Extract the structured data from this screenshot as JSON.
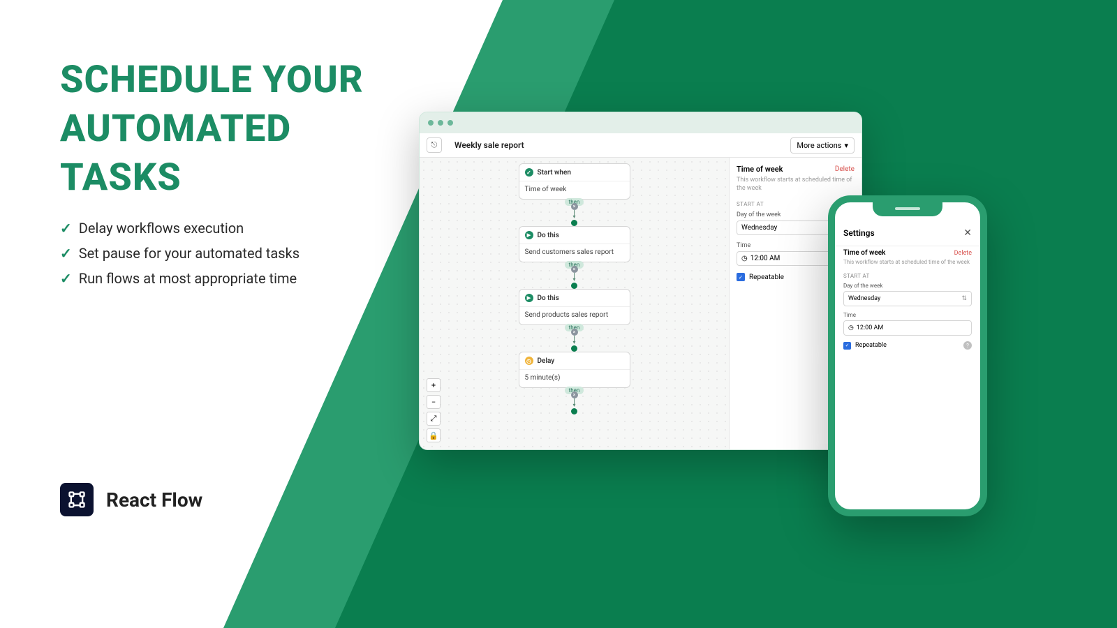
{
  "hero": {
    "heading_l1": "SCHEDULE YOUR",
    "heading_l2": "AUTOMATED",
    "heading_l3": "TASKS",
    "bullets": [
      "Delay workflows execution",
      "Set pause for your automated tasks",
      "Run flows at most appropriate time"
    ],
    "brand": "React Flow"
  },
  "desktop": {
    "title": "Weekly sale report",
    "more_actions": "More actions",
    "nodes": [
      {
        "head": "Start when",
        "body": "Time of week",
        "icon": "check"
      },
      {
        "head": "Do this",
        "body": "Send customers sales report",
        "icon": "play"
      },
      {
        "head": "Do this",
        "body": "Send products sales report",
        "icon": "play"
      },
      {
        "head": "Delay",
        "body": "5 minute(s)",
        "icon": "clock"
      }
    ],
    "connector_label": "then",
    "panel": {
      "title": "Time of week",
      "delete": "Delete",
      "desc": "This workflow starts at scheduled time of the week",
      "section_label": "START AT",
      "day_label": "Day of the week",
      "day_value": "Wednesday",
      "time_label": "Time",
      "time_value": "12:00 AM",
      "repeatable_label": "Repeatable"
    }
  },
  "mobile": {
    "title": "Settings",
    "panel": {
      "title": "Time of week",
      "delete": "Delete",
      "desc": "This workflow starts at scheduled time of the week",
      "section_label": "START AT",
      "day_label": "Day of the week",
      "day_value": "Wednesday",
      "time_label": "Time",
      "time_value": "12:00 AM",
      "repeatable_label": "Repeatable"
    }
  }
}
